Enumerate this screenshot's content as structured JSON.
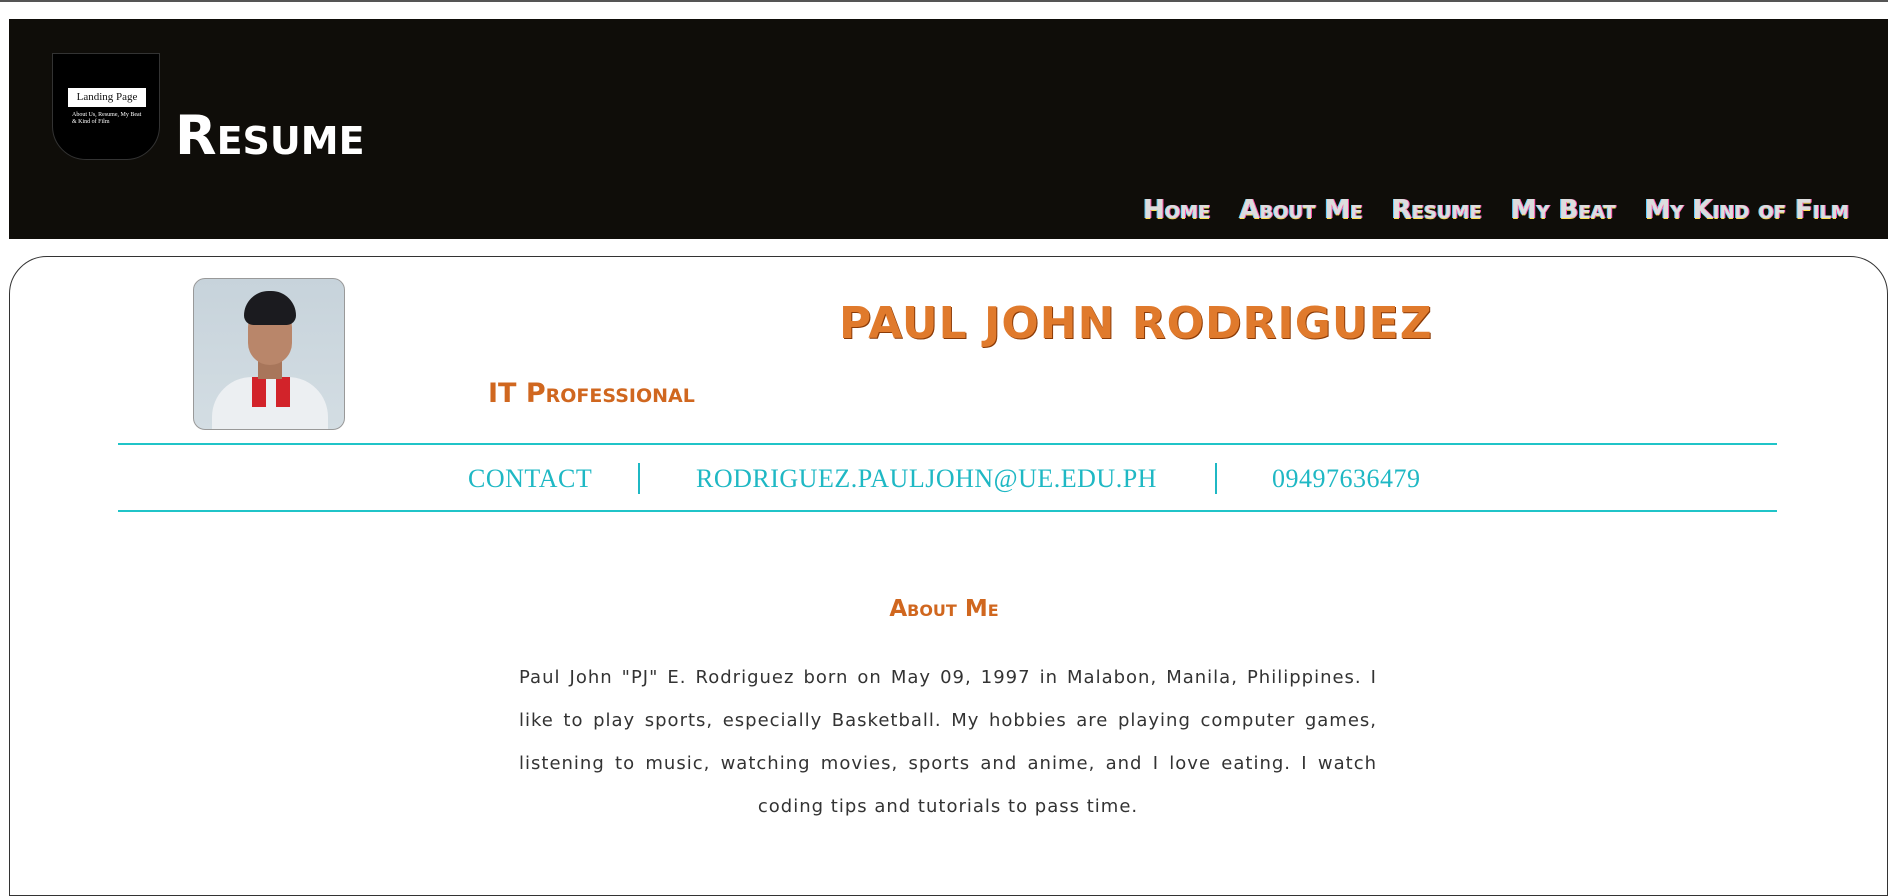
{
  "header": {
    "logo": {
      "label": "Landing Page",
      "subtext": "About Us, Resume, My Beat & Kind of Film"
    },
    "site_title": "Resume",
    "background_color": "#0f0d09",
    "nav": [
      {
        "label": "Home"
      },
      {
        "label": "About Me"
      },
      {
        "label": "Resume"
      },
      {
        "label": "My Beat"
      },
      {
        "label": "My Kind of Film"
      }
    ]
  },
  "profile": {
    "photo_icon": "avatar-photo-icon",
    "name": "PAUL JOHN RODRIGUEZ",
    "role": "IT Professional",
    "accent_color": "#e07a2c"
  },
  "contact": {
    "label": "CONTACT",
    "email": "RODRIGUEZ.PAULJOHN@UE.EDU.PH",
    "phone": "09497636479",
    "color": "#1fb8c4"
  },
  "about": {
    "title": "About Me",
    "text": "Paul John \"PJ\" E. Rodriguez born on May 09, 1997 in Malabon, Manila, Philippines. I like to play sports, especially Basketball. My hobbies are playing computer games, listening to music, watching movies, sports and anime, and I love eating. I watch coding tips and tutorials to pass time."
  }
}
